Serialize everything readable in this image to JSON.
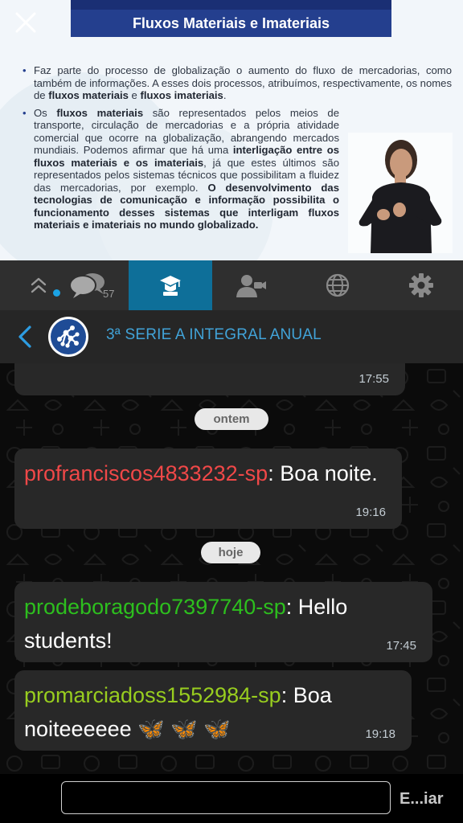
{
  "video": {
    "slide_title": "Fluxos Materiais e Imateriais",
    "bullet1": [
      {
        "t": "Faz parte do processo de globalização o aumento do fluxo de mercadorias, como também de informações. A esses dois processos, atribuímos, respectivamente, os nomes de ",
        "b": false
      },
      {
        "t": "fluxos materiais",
        "b": true
      },
      {
        "t": " e ",
        "b": false
      },
      {
        "t": "fluxos imateriais",
        "b": true
      },
      {
        "t": ".",
        "b": false
      }
    ],
    "bullet2": [
      {
        "t": "Os ",
        "b": false
      },
      {
        "t": "fluxos materiais",
        "b": true
      },
      {
        "t": " são representados pelos meios de transporte, circulação de mercadorias e a própria atividade comercial que ocorre na globalização, abrangendo mercados mundiais. Podemos afirmar que há uma ",
        "b": false
      },
      {
        "t": "interligação entre os fluxos materiais e os imateriais",
        "b": true
      },
      {
        "t": ", já que estes últimos são representados pelos sistemas técnicos que possibilitam a fluidez das mercadorias, por exemplo. ",
        "b": false
      },
      {
        "t": "O desenvolvimento das tecnologias de comunicação e informação possibilita o funcionamento desses sistemas que interligam fluxos materiais e imateriais no mundo globalizado.",
        "b": true
      }
    ]
  },
  "tabs": [
    {
      "id": "collapse",
      "icon": "chevrons-up-icon"
    },
    {
      "id": "chat",
      "icon": "chat-bubbles-icon",
      "badge": "57"
    },
    {
      "id": "class",
      "icon": "graduation-cap-icon",
      "active": true
    },
    {
      "id": "video-call",
      "icon": "user-video-icon"
    },
    {
      "id": "web",
      "icon": "globe-icon"
    },
    {
      "id": "settings",
      "icon": "gear-icon"
    }
  ],
  "channel": {
    "title": "3ª SERIE A INTEGRAL ANUAL",
    "logo_icon": "network-nodes-logo"
  },
  "chat": {
    "messages": [
      {
        "sender": "",
        "text": "",
        "time": "17:55"
      },
      {
        "sender": "profranciscos4833232-sp",
        "text": ": Boa noite.",
        "time": "19:16",
        "color": "#f04848"
      },
      {
        "sender": "prodeboragodo7397740-sp",
        "text": ": Hello students!",
        "time": "17:45",
        "color": "#2dbf1e"
      },
      {
        "sender": "promarciadoss1552984-sp",
        "text": ": Boa noiteeeeee 🦋 🦋 🦋",
        "time": "19:18",
        "color": "#98cd1f"
      }
    ],
    "date_chips": [
      "ontem",
      "hoje"
    ]
  },
  "input": {
    "value": "",
    "placeholder": "",
    "send_label": "E...iar"
  },
  "colors": {
    "accent": "#0e6f99",
    "channel_title": "#41a3d8",
    "bubble": "#282828",
    "slide_header": "#243f8e"
  }
}
